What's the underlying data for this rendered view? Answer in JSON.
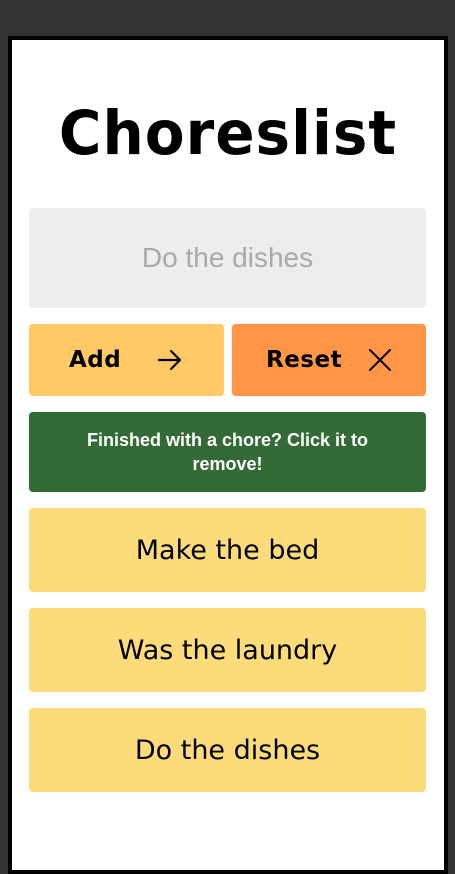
{
  "app": {
    "title": "Choreslist"
  },
  "input": {
    "placeholder": "Do the dishes",
    "value": ""
  },
  "buttons": {
    "add_label": "Add",
    "add_icon": "arrow-right-icon",
    "reset_label": "Reset",
    "reset_icon": "close-icon"
  },
  "notice": {
    "text": "Finished with a chore? Click it to remove!"
  },
  "chores": [
    "Make the bed",
    "Was the laundry",
    "Do the dishes"
  ],
  "colors": {
    "background": "#333333",
    "frame": "#ffffff",
    "input_bg": "#ededed",
    "add_button": "#ffca66",
    "reset_button": "#ff9545",
    "notice_bg": "#336a35",
    "chore_bg": "#fcdc7a"
  }
}
